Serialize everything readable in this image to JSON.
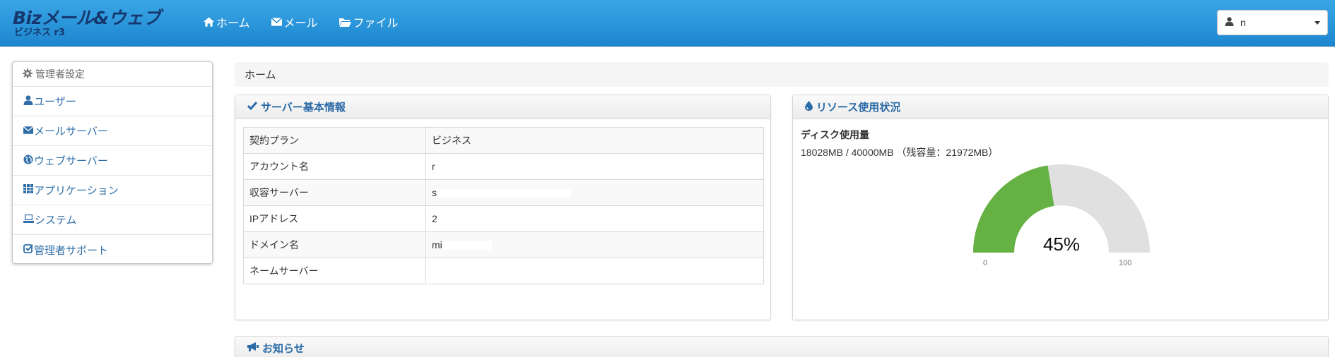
{
  "header": {
    "logo_main": "Bizメール&ウェブ",
    "logo_sub": "ビジネス r3",
    "nav": [
      {
        "label": "ホーム",
        "icon": "home-icon"
      },
      {
        "label": "メール",
        "icon": "envelope-icon"
      },
      {
        "label": "ファイル",
        "icon": "folder-icon"
      }
    ],
    "user_name": "n"
  },
  "sidebar": {
    "title": "管理者設定",
    "items": [
      {
        "label": "ユーザー",
        "icon": "user-icon"
      },
      {
        "label": "メールサーバー",
        "icon": "envelope-icon"
      },
      {
        "label": "ウェブサーバー",
        "icon": "globe-icon"
      },
      {
        "label": "アプリケーション",
        "icon": "apps-icon"
      },
      {
        "label": "システム",
        "icon": "laptop-icon"
      },
      {
        "label": "管理者サポート",
        "icon": "check-square-icon"
      }
    ]
  },
  "breadcrumb": "ホーム",
  "server_panel": {
    "title": "サーバー基本情報",
    "rows": [
      {
        "key": "契約プラン",
        "value": "ビジネス"
      },
      {
        "key": "アカウント名",
        "value": "r"
      },
      {
        "key": "収容サーバー",
        "value": "s"
      },
      {
        "key": "IPアドレス",
        "value": "2"
      },
      {
        "key": "ドメイン名",
        "value": "mi"
      },
      {
        "key": "ネームサーバー",
        "value": ""
      }
    ]
  },
  "resource_panel": {
    "title": "リソース使用状況",
    "disk_title": "ディスク使用量",
    "disk_detail": "18028MB / 40000MB （残容量：21972MB）",
    "gauge_percent_label": "45%",
    "gauge_fraction": 0.45,
    "gauge_min": "0",
    "gauge_max": "100",
    "gauge_fill_color": "#66b143",
    "gauge_track_color": "#e0e0e0"
  },
  "notice_panel": {
    "title": "お知らせ"
  },
  "colors": {
    "header_top": "#3aa6e6",
    "header_bottom": "#1d86cf",
    "link": "#2f6ea8"
  }
}
